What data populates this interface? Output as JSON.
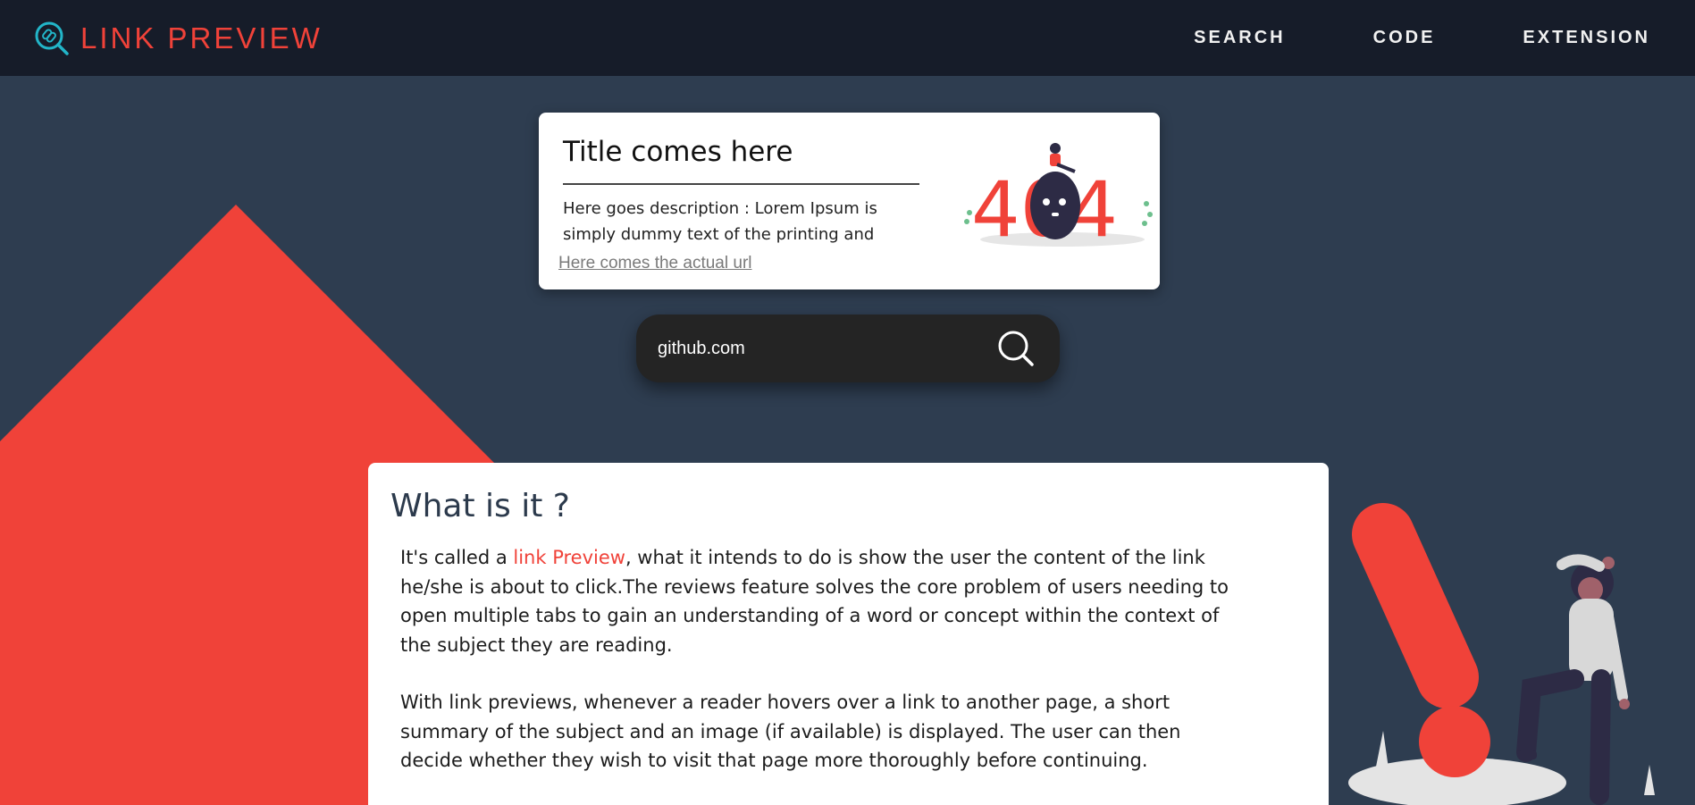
{
  "nav": {
    "brand": "LINK PREVIEW",
    "links": [
      "SEARCH",
      "CODE",
      "EXTENSION"
    ]
  },
  "preview": {
    "title": "Title comes here",
    "description": "Here goes description : Lorem Ipsum is simply dummy text of the printing and typesetting industry.",
    "url": "Here comes the actual url",
    "image_text": "404"
  },
  "search": {
    "value": "github.com",
    "icon": "search-icon"
  },
  "info": {
    "heading": "What is it ?",
    "p1_before": "It's called a ",
    "p1_link": "link Preview",
    "p1_after": ", what it intends to do is show the user the content of the link he/she is about to click.The reviews feature solves the core problem of users needing to open multiple tabs to gain an understanding of a word or concept within the context of the subject they are reading.",
    "p2": "With link previews, whenever a reader hovers over a link to another page, a short summary of the subject and an image (if available) is displayed. The user can then decide whether they wish to visit that page more thoroughly before continuing."
  },
  "colors": {
    "nav_bg": "#161c29",
    "page_bg": "#2e3d50",
    "accent": "#f04239",
    "brand_icon": "#22b5c8"
  }
}
